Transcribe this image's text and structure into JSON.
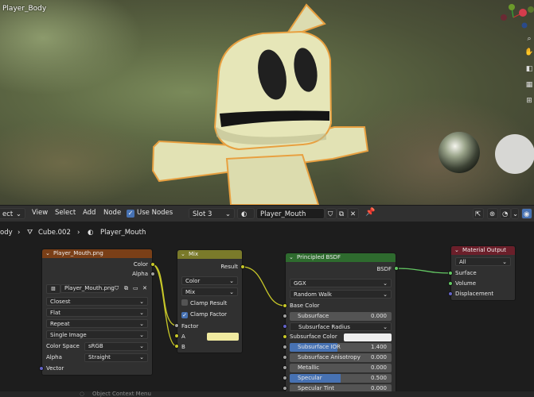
{
  "viewport": {
    "object_name": "Player_Body"
  },
  "header": {
    "mode_label": "ect",
    "menu": [
      "View",
      "Select",
      "Add",
      "Node"
    ],
    "use_nodes_label": "Use Nodes",
    "slot_label": "Slot 3",
    "material_name": "Player_Mouth"
  },
  "breadcrumb": {
    "item1": "ody",
    "item2": "Cube.002",
    "item3": "Player_Mouth"
  },
  "image_node": {
    "title": "Player_Mouth.png",
    "out_color": "Color",
    "out_alpha": "Alpha",
    "image_name": "Player_Mouth.png",
    "interpolation": "Closest",
    "projection": "Flat",
    "extension": "Repeat",
    "source": "Single Image",
    "color_space_label": "Color Space",
    "color_space_value": "sRGB",
    "alpha_label": "Alpha",
    "alpha_value": "Straight",
    "in_vector": "Vector"
  },
  "mix_node": {
    "title": "Mix",
    "out_result": "Result",
    "data_type": "Color",
    "blend_mode": "Mix",
    "clamp_result": "Clamp Result",
    "clamp_factor": "Clamp Factor",
    "in_factor": "Factor",
    "in_a": "A",
    "in_b": "B",
    "a_color": "#f0eaa0"
  },
  "bsdf_node": {
    "title": "Principled BSDF",
    "out_bsdf": "BSDF",
    "distribution": "GGX",
    "subsurface_method": "Random Walk",
    "base_color": "Base Color",
    "subsurface_label": "Subsurface",
    "subsurface_value": "0.000",
    "subsurface_radius": "Subsurface Radius",
    "subsurface_color": "Subsurface Color",
    "subsurface_ior_label": "Subsurface IOR",
    "subsurface_ior_value": "1.400",
    "subsurface_aniso_label": "Subsurface Anisotropy",
    "subsurface_aniso_value": "0.000",
    "metallic_label": "Metallic",
    "metallic_value": "0.000",
    "specular_label": "Specular",
    "specular_value": "0.500",
    "specular_fill": 0.5,
    "specular_tint_label": "Specular Tint",
    "specular_tint_value": "0.000"
  },
  "output_node": {
    "title": "Material Output",
    "target": "All",
    "in_surface": "Surface",
    "in_volume": "Volume",
    "in_displacement": "Displacement"
  },
  "footer": {
    "hint": "Object Context Menu"
  },
  "colors": {
    "image_header": "#7a3f17",
    "mix_header": "#7a7a2a",
    "bsdf_header": "#2e6b2e",
    "output_header": "#6b1f2a",
    "color_socket": "#c7c729",
    "shader_socket": "#63c763",
    "float_socket": "#a1a1a1",
    "vector_socket": "#6363c7",
    "accent_blue": "#4772b3"
  }
}
